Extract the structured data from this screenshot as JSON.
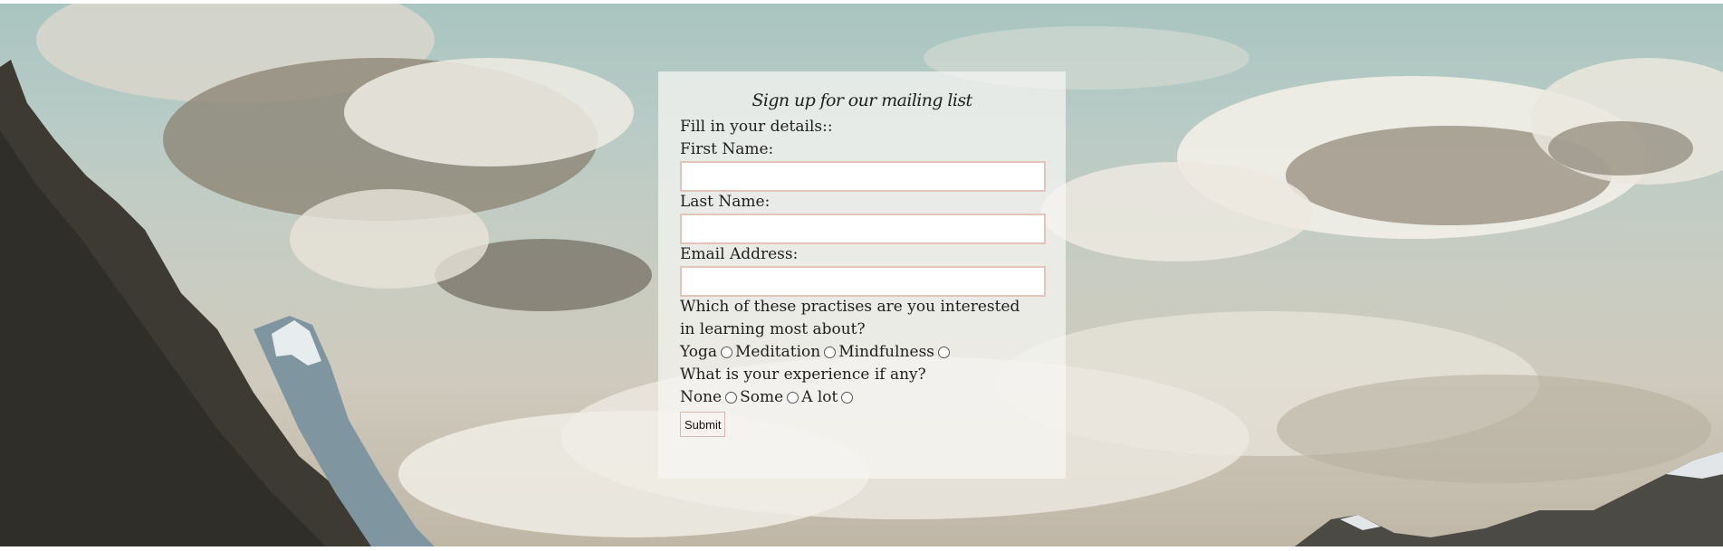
{
  "form": {
    "title": "Sign up for our mailing list",
    "intro": "Fill in your details::",
    "first_name_label": "First Name:",
    "first_name_value": "",
    "last_name_label": "Last Name:",
    "last_name_value": "",
    "email_label": "Email Address:",
    "email_value": "",
    "practices_question": "Which of these practises are you interested in learning most about?",
    "practices": [
      "Yoga",
      "Meditation",
      "Mindfulness"
    ],
    "experience_question": "What is your experience if any?",
    "experience": [
      "None",
      "Some",
      "A lot"
    ],
    "submit_label": "Submit"
  },
  "colors": {
    "panel_background": "#f5f5f3",
    "input_border": "#e2c4b8",
    "text": "#1e1e1e"
  }
}
